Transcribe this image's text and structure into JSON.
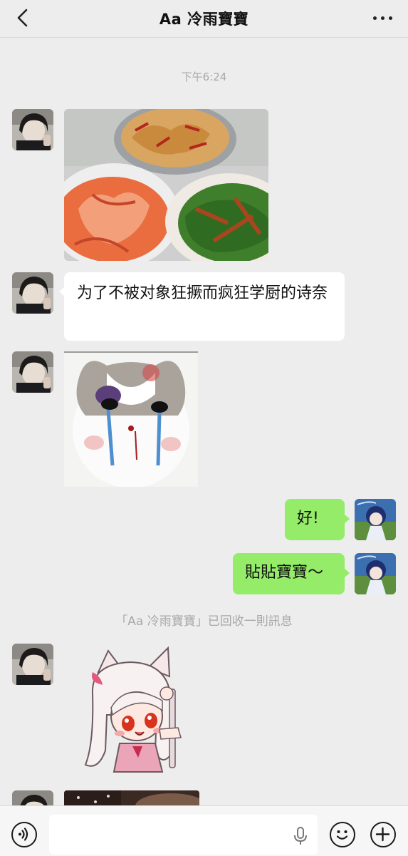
{
  "header": {
    "title": "Aa 冷雨寶寶"
  },
  "chat": {
    "timestamp": "下午6:24",
    "messages": [
      {
        "side": "left",
        "type": "image",
        "alt": ""
      },
      {
        "side": "left",
        "type": "text",
        "text": "为了不被对象狂撅而疯狂学厨的诗奈"
      },
      {
        "side": "left",
        "type": "sticker",
        "alt": ""
      },
      {
        "side": "right",
        "type": "text",
        "text": "好!"
      },
      {
        "side": "right",
        "type": "text",
        "text": "貼貼寶寶～"
      },
      {
        "side": "left",
        "type": "sticker",
        "alt": ""
      },
      {
        "side": "left",
        "type": "image",
        "alt": ""
      }
    ],
    "recall_notice": "「Aa 冷雨寶寶」已回收一則訊息"
  },
  "input_bar": {
    "text_value": "",
    "icons": [
      "voice-mode-icon",
      "mic-icon",
      "emoji-icon",
      "plus-icon"
    ]
  },
  "colors": {
    "background": "#ededed",
    "bubble_self": "#95ec69",
    "bubble_other": "#ffffff",
    "meta_text": "#a8a8a8"
  }
}
